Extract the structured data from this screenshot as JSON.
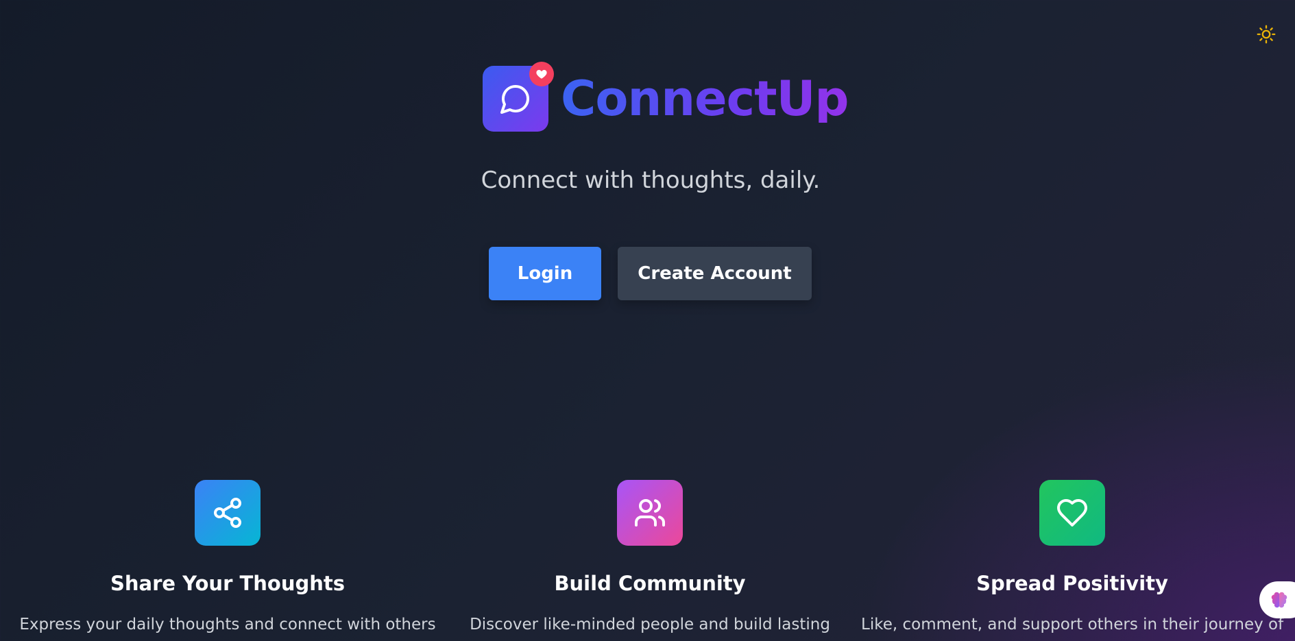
{
  "header": {
    "theme_toggle_icon": "sun-icon",
    "accent_sun": "#eab308"
  },
  "brand": {
    "name": "ConnectUp",
    "logo_icon": "chat-bubble-icon",
    "badge_icon": "heart-icon",
    "tagline": "Connect with thoughts, daily."
  },
  "actions": {
    "login_label": "Login",
    "create_account_label": "Create Account"
  },
  "features": [
    {
      "icon": "share-icon",
      "title": "Share Your Thoughts",
      "description": "Express your daily thoughts and connect with others"
    },
    {
      "icon": "users-icon",
      "title": "Build Community",
      "description": "Discover like-minded people and build lasting"
    },
    {
      "icon": "heart-icon",
      "title": "Spread Positivity",
      "description": "Like, comment, and support others in their journey of"
    }
  ],
  "colors": {
    "primary": "#3b82f6",
    "secondary_button": "#374151",
    "brand_gradient_start": "#3b63f2",
    "brand_gradient_end": "#9333ea",
    "badge": "#f43f5e"
  },
  "assistant": {
    "icon": "brain-icon"
  }
}
